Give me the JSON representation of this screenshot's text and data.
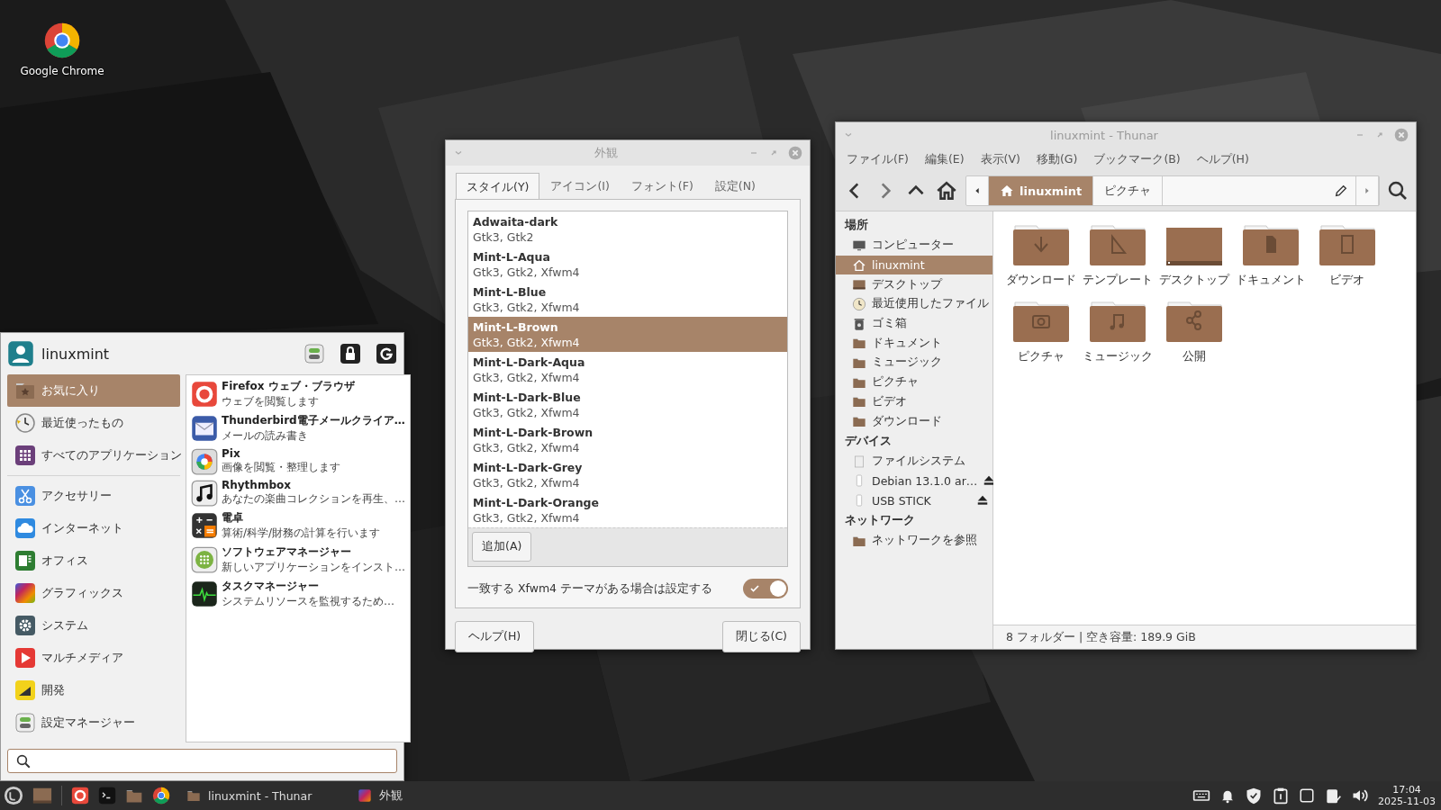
{
  "desktop": {
    "icons": [
      {
        "label": "Google Chrome"
      }
    ]
  },
  "menu": {
    "user": "linuxmint",
    "top_items": [
      {
        "label": "お気に入り",
        "selected": true
      },
      {
        "label": "最近使ったもの",
        "selected": false
      },
      {
        "label": "すべてのアプリケーション",
        "selected": false
      }
    ],
    "categories": [
      {
        "label": "アクセサリー",
        "selected": false
      },
      {
        "label": "インターネット",
        "selected": false
      },
      {
        "label": "オフィス",
        "selected": false
      },
      {
        "label": "グラフィックス",
        "selected": false
      },
      {
        "label": "システム",
        "selected": false
      },
      {
        "label": "マルチメディア",
        "selected": false
      },
      {
        "label": "開発",
        "selected": false
      },
      {
        "label": "設定マネージャー",
        "selected": false
      }
    ],
    "apps": [
      {
        "name": "Firefox ウェブ・ブラウザ",
        "description": "ウェブを閲覧します"
      },
      {
        "name": "Thunderbird電子メールクライア…",
        "description": "メールの読み書き"
      },
      {
        "name": "Pix",
        "description": "画像を閲覧・整理します"
      },
      {
        "name": "Rhythmbox",
        "description": "あなたの楽曲コレクションを再生、…"
      },
      {
        "name": "電卓",
        "description": "算術/科学/財務の計算を行います"
      },
      {
        "name": "ソフトウェアマネージャー",
        "description": "新しいアプリケーションをインスト…"
      },
      {
        "name": "タスクマネージャー",
        "description": "システムリソースを監視するため…"
      }
    ]
  },
  "dialog": {
    "title": "外観",
    "tabs": [
      {
        "label": "スタイル(Y)",
        "selected": true
      },
      {
        "label": "アイコン(I)",
        "selected": false
      },
      {
        "label": "フォント(F)",
        "selected": false
      },
      {
        "label": "設定(N)",
        "selected": false
      }
    ],
    "themes": [
      {
        "name": "Adwaita-dark",
        "info": "Gtk3, Gtk2",
        "selected": false
      },
      {
        "name": "Mint-L-Aqua",
        "info": "Gtk3, Gtk2, Xfwm4",
        "selected": false
      },
      {
        "name": "Mint-L-Blue",
        "info": "Gtk3, Gtk2, Xfwm4",
        "selected": false
      },
      {
        "name": "Mint-L-Brown",
        "info": "Gtk3, Gtk2, Xfwm4",
        "selected": true
      },
      {
        "name": "Mint-L-Dark-Aqua",
        "info": "Gtk3, Gtk2, Xfwm4",
        "selected": false
      },
      {
        "name": "Mint-L-Dark-Blue",
        "info": "Gtk3, Gtk2, Xfwm4",
        "selected": false
      },
      {
        "name": "Mint-L-Dark-Brown",
        "info": "Gtk3, Gtk2, Xfwm4",
        "selected": false
      },
      {
        "name": "Mint-L-Dark-Grey",
        "info": "Gtk3, Gtk2, Xfwm4",
        "selected": false
      },
      {
        "name": "Mint-L-Dark-Orange",
        "info": "Gtk3, Gtk2, Xfwm4",
        "selected": false
      }
    ],
    "add_button": "追加(A)",
    "option": {
      "label": "一致する Xfwm4 テーマがある場合は設定する",
      "on": true
    },
    "help_button": "ヘルプ(H)",
    "close_button": "閉じる(C)"
  },
  "file_manager": {
    "title": "linuxmint - Thunar",
    "menu": [
      "ファイル(F)",
      "編集(E)",
      "表示(V)",
      "移動(G)",
      "ブックマーク(B)",
      "ヘルプ(H)"
    ],
    "path": [
      {
        "label": "linuxmint",
        "selected": true
      },
      {
        "label": "ピクチャ",
        "selected": false
      }
    ],
    "sidebar": [
      {
        "heading": "場所",
        "items": [
          {
            "label": "コンピューター",
            "selected": false
          },
          {
            "label": "linuxmint",
            "selected": true
          },
          {
            "label": "デスクトップ",
            "selected": false
          },
          {
            "label": "最近使用したファイル",
            "selected": false
          },
          {
            "label": "ゴミ箱",
            "selected": false
          },
          {
            "label": "ドキュメント",
            "selected": false
          },
          {
            "label": "ミュージック",
            "selected": false
          },
          {
            "label": "ピクチャ",
            "selected": false
          },
          {
            "label": "ビデオ",
            "selected": false
          },
          {
            "label": "ダウンロード",
            "selected": false
          }
        ]
      },
      {
        "heading": "デバイス",
        "items": [
          {
            "label": "ファイルシステム",
            "ejectable": false
          },
          {
            "label": "Debian 13.1.0 ar…",
            "ejectable": true
          },
          {
            "label": "USB STICK",
            "ejectable": true
          }
        ]
      },
      {
        "heading": "ネットワーク",
        "items": [
          {
            "label": "ネットワークを参照"
          }
        ]
      }
    ],
    "files": [
      {
        "label": "ダウンロード"
      },
      {
        "label": "テンプレート"
      },
      {
        "label": "デスクトップ"
      },
      {
        "label": "ドキュメント"
      },
      {
        "label": "ビデオ"
      },
      {
        "label": "ピクチャ"
      },
      {
        "label": "ミュージック"
      },
      {
        "label": "公開"
      }
    ],
    "status": "8 フォルダー | 空き容量: 189.9 GiB"
  },
  "taskbar": {
    "windows": [
      {
        "label": "linuxmint - Thunar"
      },
      {
        "label": "外観"
      }
    ],
    "time": "17:04",
    "date": "2025-11-03"
  }
}
